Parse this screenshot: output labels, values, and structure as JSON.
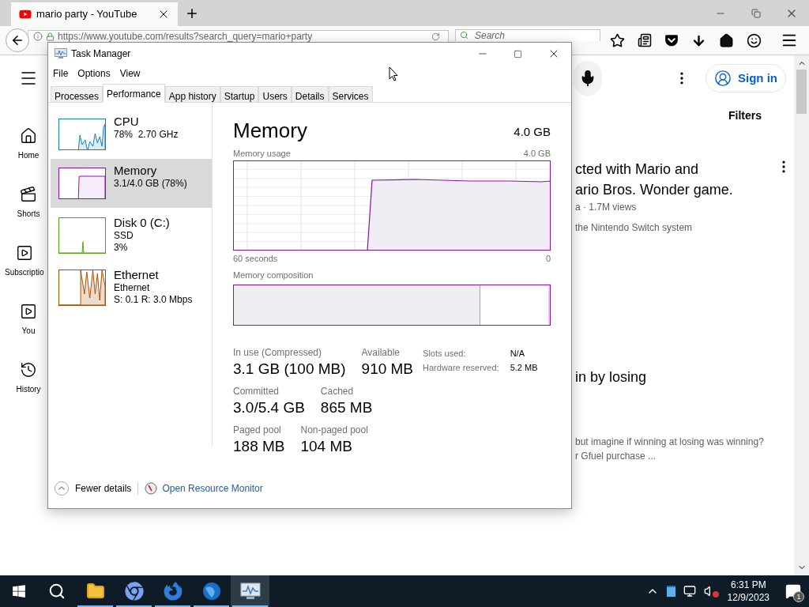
{
  "browser": {
    "tab": {
      "title": "mario party - YouTube"
    },
    "url": "https://www.youtube.com/results?search_query=mario+party",
    "search": {
      "placeholder": "Search"
    }
  },
  "youtube": {
    "sidebar": [
      {
        "kind": "home",
        "label": "Home"
      },
      {
        "kind": "shorts",
        "label": "Shorts"
      },
      {
        "kind": "subscriptions",
        "label": "Subscriptio"
      },
      {
        "kind": "you",
        "label": "You"
      },
      {
        "kind": "history",
        "label": "History"
      }
    ],
    "sign_in": "Sign in",
    "filters": "Filters",
    "results": [
      {
        "title_lines": [
          "cted with Mario and",
          "ario Bros. Wonder game."
        ],
        "meta": "a · 1.7M views",
        "description": [
          "the Nintendo Switch system"
        ]
      },
      {
        "title_lines": [
          "in by losing"
        ],
        "description": [
          "but imagine if winning at losing was winning?",
          "r Gfuel purchase ..."
        ]
      }
    ]
  },
  "task_manager": {
    "title": "Task Manager",
    "menu": [
      "File",
      "Options",
      "View"
    ],
    "tabs": [
      {
        "label": "Processes",
        "selected": false
      },
      {
        "label": "Performance",
        "selected": true
      },
      {
        "label": "App history",
        "selected": false
      },
      {
        "label": "Startup",
        "selected": false
      },
      {
        "label": "Users",
        "selected": false
      },
      {
        "label": "Details",
        "selected": false
      },
      {
        "label": "Services",
        "selected": false
      }
    ],
    "resources": [
      {
        "kind": "cpu",
        "name": "CPU",
        "lines": [
          "78%  2.70 GHz"
        ],
        "selected": false,
        "color": "#117dbb"
      },
      {
        "kind": "memory",
        "name": "Memory",
        "lines": [
          "3.1/4.0 GB (78%)"
        ],
        "selected": true,
        "color": "#8b12ae"
      },
      {
        "kind": "disk",
        "name": "Disk 0 (C:)",
        "lines": [
          "SSD",
          "3%"
        ],
        "selected": false,
        "color": "#4da60c"
      },
      {
        "kind": "ethernet",
        "name": "Ethernet",
        "lines": [
          "Ethernet",
          "S: 0.1 R: 3.0 Mbps"
        ],
        "selected": false,
        "color": "#a74f01"
      }
    ],
    "detail": {
      "heading": "Memory",
      "total": "4.0 GB",
      "usage_label": "Memory usage",
      "usage_max": "4.0 GB",
      "x_start": "60 seconds",
      "x_end": "0",
      "composition_label": "Memory composition",
      "composition": {
        "level": 0.78
      },
      "stats": [
        [
          {
            "label": "In use (Compressed)",
            "value": "3.1 GB (100 MB)"
          },
          {
            "label": "Available",
            "value": "910 MB"
          }
        ],
        [
          {
            "label": "Committed",
            "value": "3.0/5.4 GB"
          },
          {
            "label": "Cached",
            "value": "865 MB"
          }
        ],
        [
          {
            "label": "Paged pool",
            "value": "188 MB"
          },
          {
            "label": "Non-paged pool",
            "value": "104 MB"
          }
        ]
      ],
      "side_stats": [
        {
          "label": "Slots used:",
          "value": "N/A"
        },
        {
          "label": "Hardware reserved:",
          "value": "5.2 MB"
        }
      ]
    },
    "footer": {
      "fewer_details": "Fewer details",
      "resource_monitor": "Open Resource Monitor"
    }
  },
  "taskbar": {
    "apps": [
      {
        "kind": "explorer",
        "running": true,
        "selected": false
      },
      {
        "kind": "chrome",
        "running": true,
        "selected": false
      },
      {
        "kind": "firefox",
        "running": true,
        "selected": false
      },
      {
        "kind": "globe",
        "running": true,
        "selected": false
      },
      {
        "kind": "taskmanager",
        "running": true,
        "selected": true
      }
    ],
    "volume_muted": true,
    "time": "6:31 PM",
    "date": "12/9/2023",
    "notifications": "1"
  }
}
